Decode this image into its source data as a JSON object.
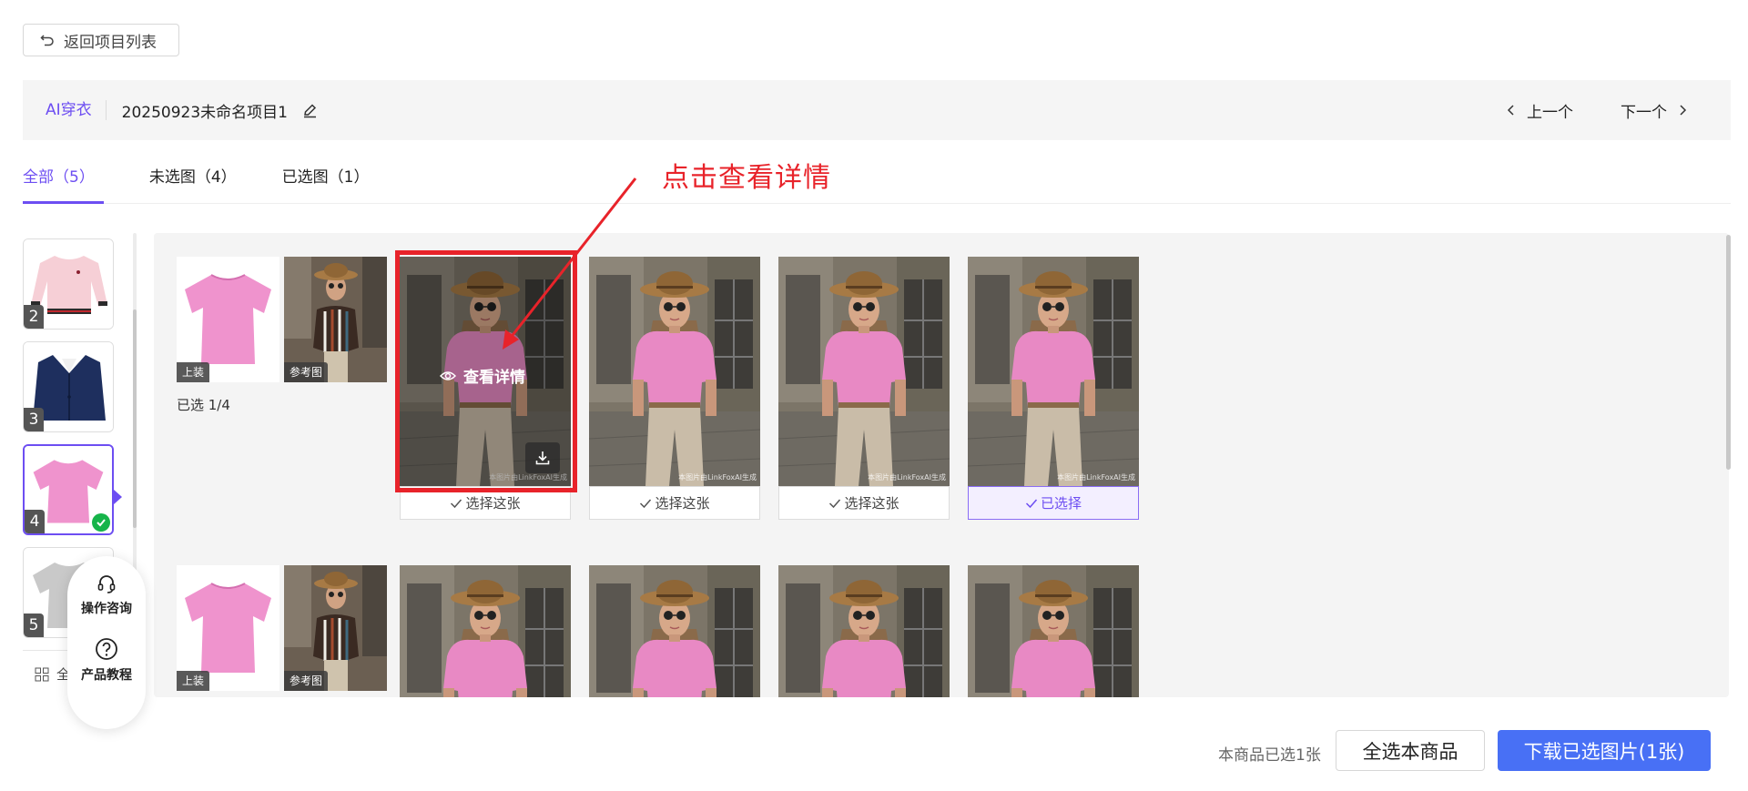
{
  "header": {
    "back_label": "返回项目列表",
    "mode_label": "AI穿衣",
    "project_name": "20250923未命名项目1",
    "prev_label": "上一个",
    "next_label": "下一个"
  },
  "tabs": [
    {
      "label": "全部（5）",
      "active": true
    },
    {
      "label": "未选图（4）",
      "active": false
    },
    {
      "label": "已选图（1）",
      "active": false
    }
  ],
  "annotation": {
    "text": "点击查看详情",
    "color": "#e8232a"
  },
  "product_thumbs": [
    {
      "number": "2",
      "garment": "pink-sweater"
    },
    {
      "number": "3",
      "garment": "navy-blazer"
    },
    {
      "number": "4",
      "garment": "pink-tshirt",
      "active": true,
      "selected": true
    },
    {
      "number": "5",
      "garment": "grey-tshirt"
    }
  ],
  "view_toggle_label": "全",
  "help": {
    "consult_label": "操作咨询",
    "tutorial_label": "产品教程"
  },
  "groups": [
    {
      "garment_tag": "上装",
      "reference_tag": "参考图",
      "selected_count": "已选 1/4",
      "results": [
        {
          "pick_label": "选择这张",
          "hover": true,
          "view_label": "查看详情",
          "watermark": "本图片由LinkFoxAI生成"
        },
        {
          "pick_label": "选择这张",
          "watermark": "本图片由LinkFoxAI生成"
        },
        {
          "pick_label": "选择这张",
          "watermark": "本图片由LinkFoxAI生成"
        },
        {
          "pick_label": "已选择",
          "selected": true,
          "watermark": "本图片由LinkFoxAI生成"
        }
      ]
    },
    {
      "garment_tag": "上装",
      "reference_tag": "参考图",
      "results": [
        {},
        {},
        {},
        {}
      ]
    }
  ],
  "footer": {
    "count_text": "本商品已选1张",
    "select_all_label": "全选本商品",
    "download_label": "下载已选图片(1张)"
  },
  "colors": {
    "accent": "#6d4ef2",
    "download": "#4870f5",
    "selected_badge": "#16b44a"
  }
}
